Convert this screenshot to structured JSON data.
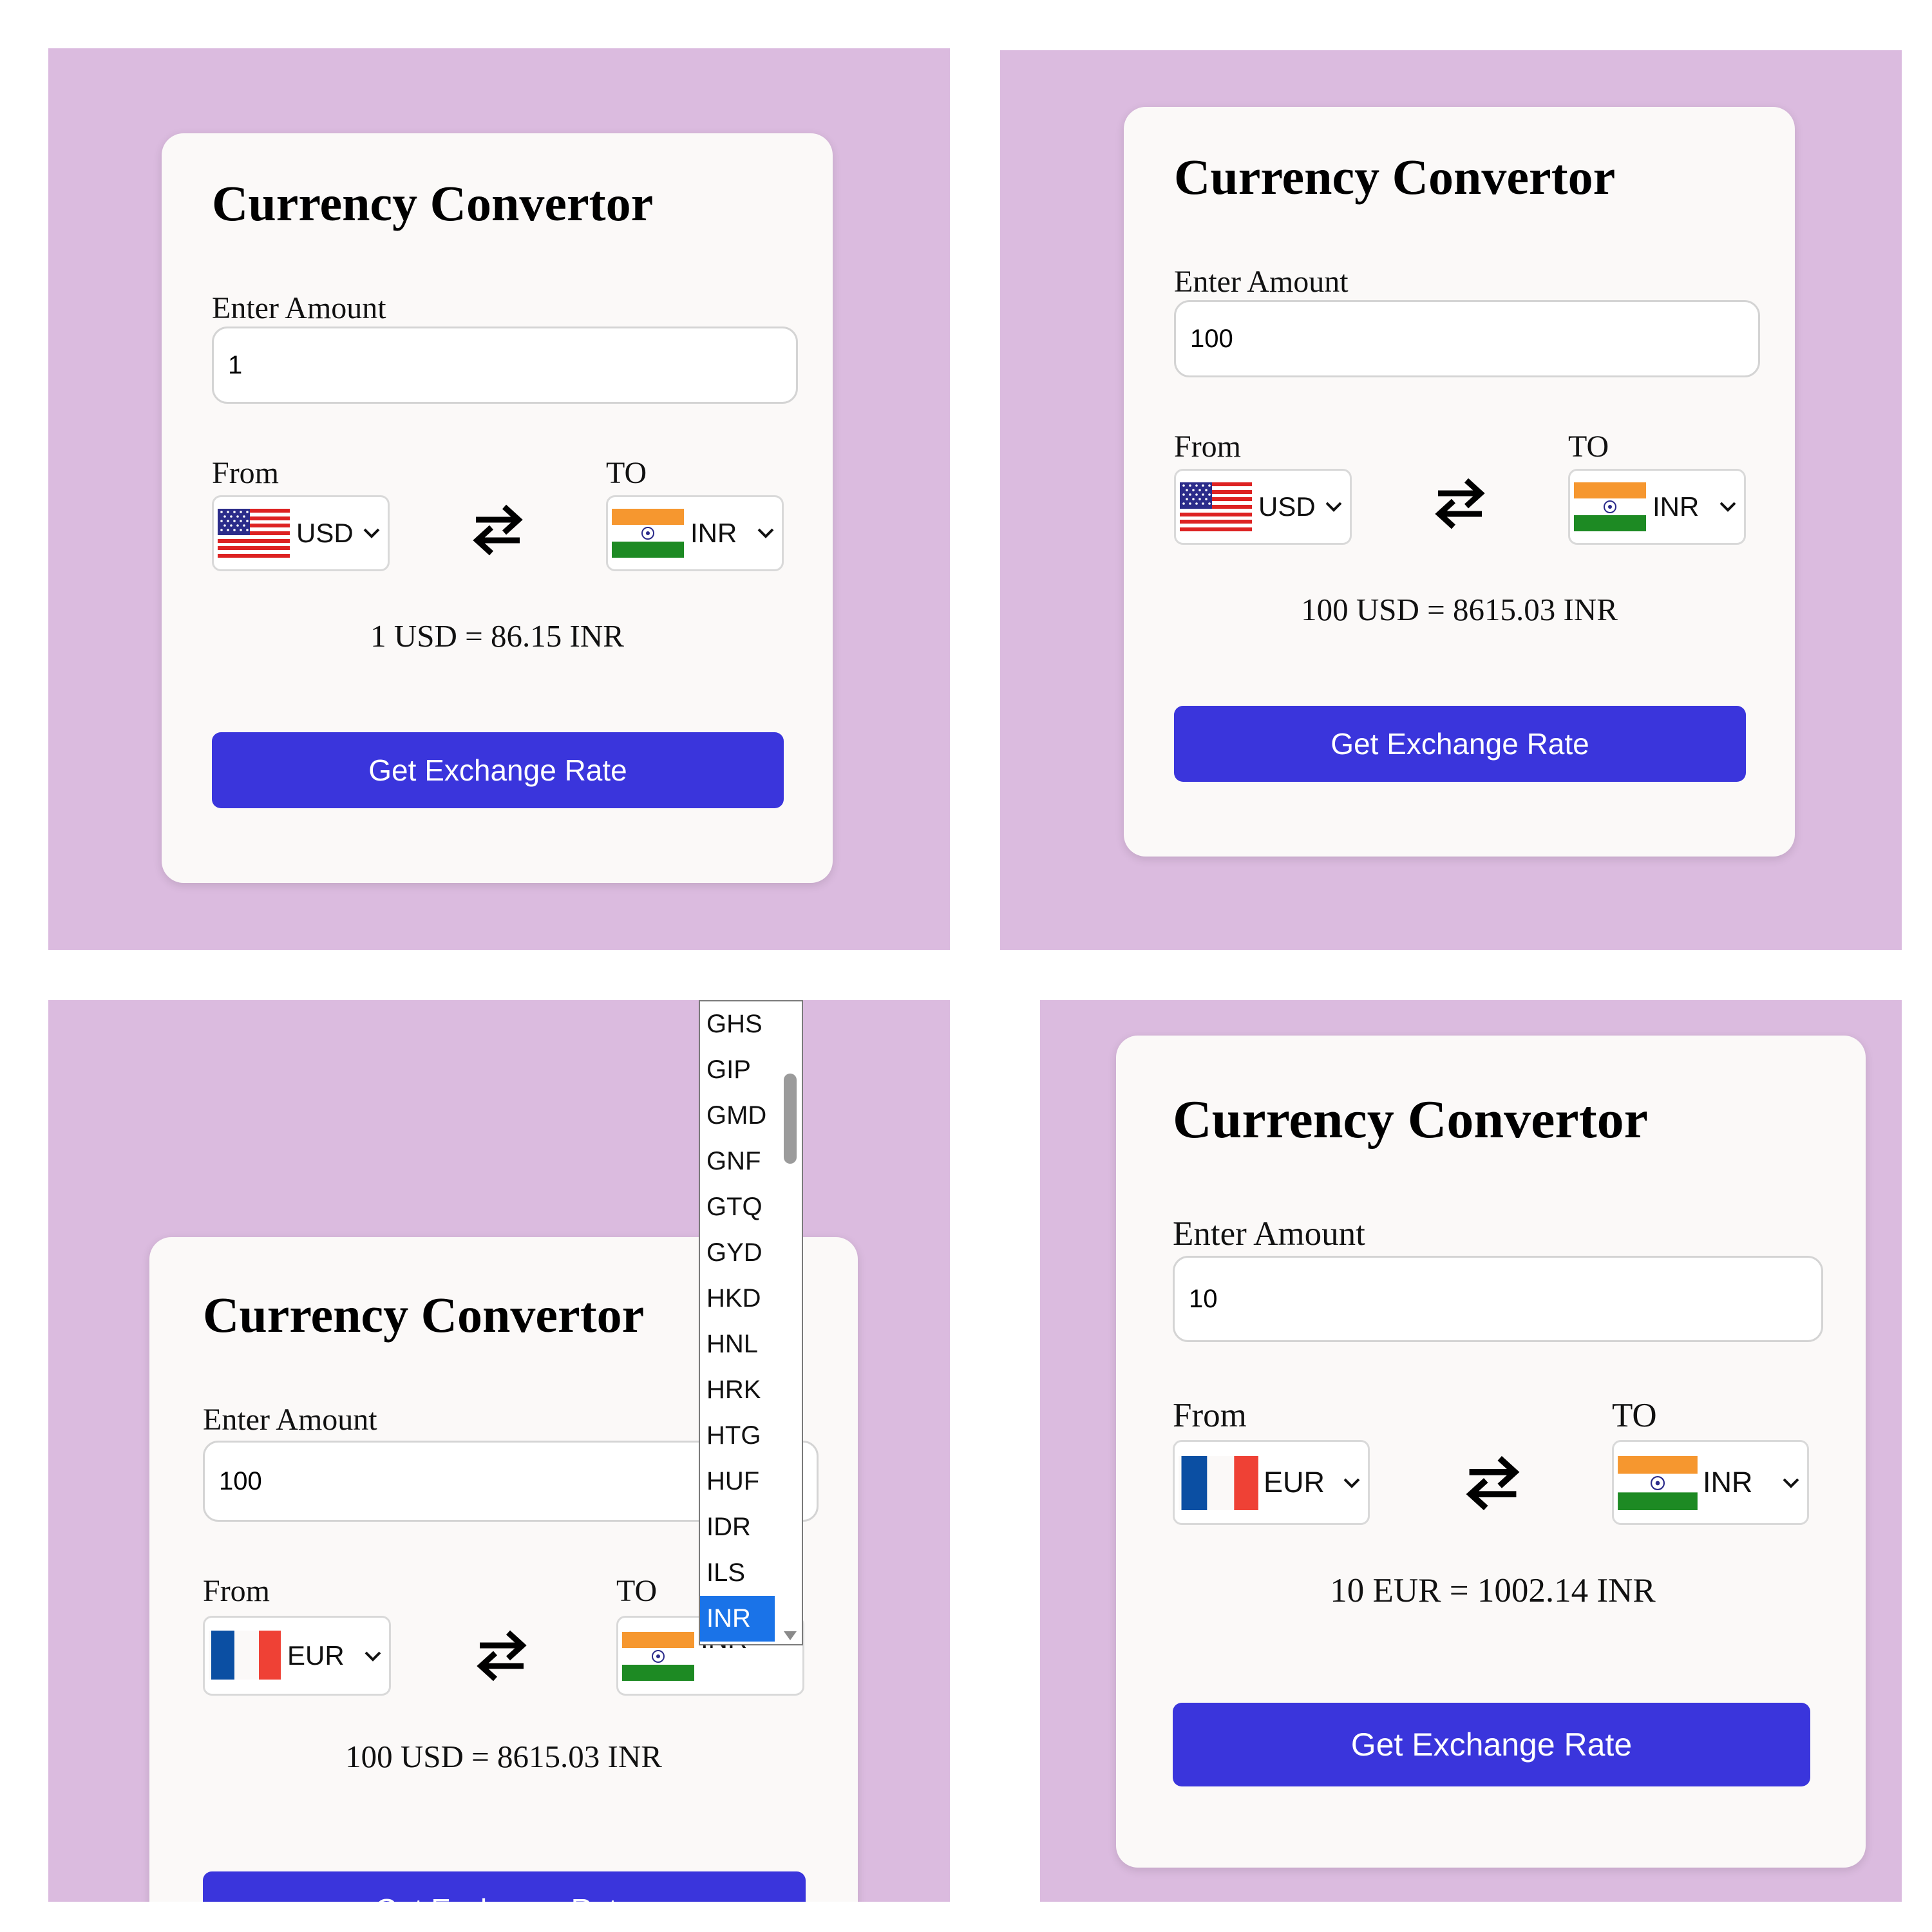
{
  "colors": {
    "background": "#dbbbdf",
    "card": "#fbf9f8",
    "button": "#3a35dc",
    "selected_option": "#1a73e8"
  },
  "panels": [
    {
      "title": "Currency Convertor",
      "amount_label": "Enter Amount",
      "amount_value": "1",
      "from_label": "From",
      "to_label": "TO",
      "from_code": "USD",
      "from_flag": "us-flag",
      "to_code": "INR",
      "to_flag": "india-flag",
      "result": "1 USD = 86.15 INR",
      "button": "Get Exchange Rate"
    },
    {
      "title": "Currency Convertor",
      "amount_label": "Enter Amount",
      "amount_value": "100",
      "from_label": "From",
      "to_label": "TO",
      "from_code": "USD",
      "from_flag": "us-flag",
      "to_code": "INR",
      "to_flag": "india-flag",
      "result": "100 USD = 8615.03 INR",
      "button": "Get Exchange Rate"
    },
    {
      "title": "Currency Convertor",
      "amount_label": "Enter Amount",
      "amount_value": "100",
      "from_label": "From",
      "to_label": "TO",
      "from_code": "EUR",
      "from_flag": "france-flag",
      "to_code": "INR",
      "to_flag": "india-flag",
      "result": "100 USD = 8615.03 INR",
      "button": "Get Exchange Rate",
      "dropdown_options": [
        "GHS",
        "GIP",
        "GMD",
        "GNF",
        "GTQ",
        "GYD",
        "HKD",
        "HNL",
        "HRK",
        "HTG",
        "HUF",
        "IDR",
        "ILS",
        "INR"
      ],
      "dropdown_selected": "INR"
    },
    {
      "title": "Currency Convertor",
      "amount_label": "Enter Amount",
      "amount_value": "10",
      "from_label": "From",
      "to_label": "TO",
      "from_code": "EUR",
      "from_flag": "france-flag",
      "to_code": "INR",
      "to_flag": "india-flag",
      "result": "10 EUR = 1002.14 INR",
      "button": "Get Exchange Rate"
    }
  ]
}
